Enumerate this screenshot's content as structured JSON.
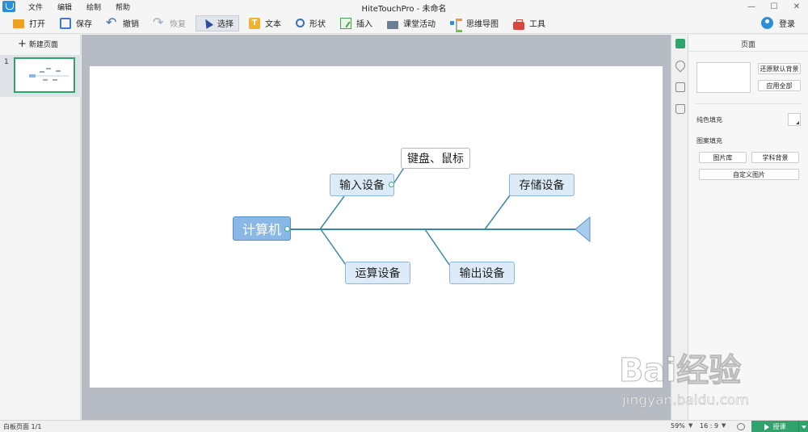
{
  "menubar": {
    "items": [
      "文件",
      "编辑",
      "绘制",
      "帮助"
    ],
    "title": "HiteTouchPro - 未命名"
  },
  "toolbar": {
    "open": "打开",
    "save": "保存",
    "undo": "撤销",
    "redo": "恢复",
    "select": "选择",
    "text": "文本",
    "shape": "形状",
    "insert": "插入",
    "classroom": "课堂活动",
    "mindmap": "思维导图",
    "tools": "工具",
    "login": "登录"
  },
  "left_panel": {
    "new_page": "新建页面",
    "page_number": "1"
  },
  "diagram": {
    "root": "计算机",
    "nodes": [
      "输入设备",
      "键盘、鼠标",
      "存储设备",
      "运算设备",
      "输出设备"
    ]
  },
  "right_panel": {
    "title": "页面",
    "restore_bg": "还原默认背景",
    "apply_all": "应用全部",
    "solid_fill": "纯色填充",
    "pattern_fill": "图案填充",
    "gallery": "图片库",
    "subject_bg": "学科背景",
    "custom_image": "自定义图片"
  },
  "statusbar": {
    "page_info": "白板页面 1/1",
    "zoom": "59%",
    "ratio": "16 : 9",
    "present": "授课"
  },
  "watermark": {
    "logo": "Bai经验",
    "url": "jingyan.baidu.com"
  },
  "colors": {
    "accent_green": "#2fa36b",
    "node_fill": "#dcebf7",
    "root_fill": "#8ab8e6",
    "line": "#3b86a8"
  }
}
